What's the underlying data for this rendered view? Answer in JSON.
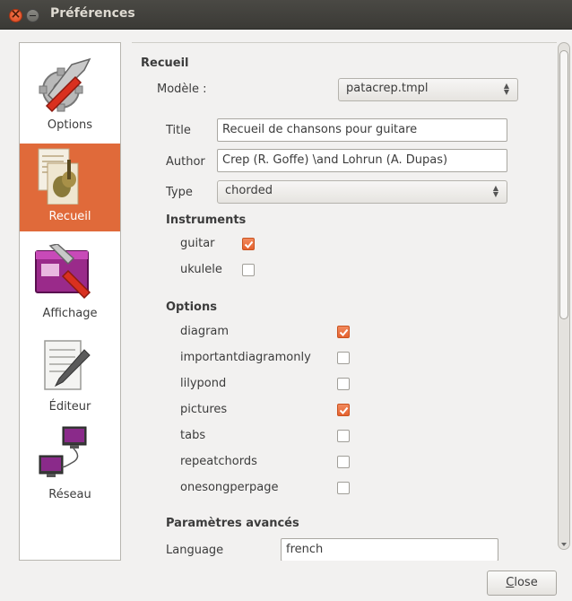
{
  "window": {
    "title": "Préférences"
  },
  "sidebar": {
    "items": [
      {
        "label": "Options",
        "icon": "options-icon",
        "selected": false
      },
      {
        "label": "Recueil",
        "icon": "recueil-icon",
        "selected": true
      },
      {
        "label": "Affichage",
        "icon": "affichage-icon",
        "selected": false
      },
      {
        "label": "Éditeur",
        "icon": "editeur-icon",
        "selected": false
      },
      {
        "label": "Réseau",
        "icon": "reseau-icon",
        "selected": false
      }
    ]
  },
  "recueil": {
    "section_title": "Recueil",
    "model_label": "Modèle :",
    "model_value": "patacrep.tmpl",
    "title_label": "Title",
    "title_value": "Recueil de chansons pour guitare",
    "author_label": "Author",
    "author_value": "Crep (R. Goffe) \\and Lohrun (A. Dupas)",
    "type_label": "Type",
    "type_value": "chorded",
    "instruments_title": "Instruments",
    "instruments": [
      {
        "label": "guitar",
        "checked": true
      },
      {
        "label": "ukulele",
        "checked": false
      }
    ],
    "options_title": "Options",
    "options": [
      {
        "label": "diagram",
        "checked": true
      },
      {
        "label": "importantdiagramonly",
        "checked": false
      },
      {
        "label": "lilypond",
        "checked": false
      },
      {
        "label": "pictures",
        "checked": true
      },
      {
        "label": "tabs",
        "checked": false
      },
      {
        "label": "repeatchords",
        "checked": false
      },
      {
        "label": "onesongperpage",
        "checked": false
      }
    ],
    "advanced_title": "Paramètres avancés",
    "language_label": "Language",
    "language_value": "french"
  },
  "footer": {
    "close_label_prefix": "",
    "close_label_mnemonic": "C",
    "close_label_rest": "lose"
  },
  "colors": {
    "accent": "#e06a3a",
    "titlebar": "#3c3b37"
  }
}
